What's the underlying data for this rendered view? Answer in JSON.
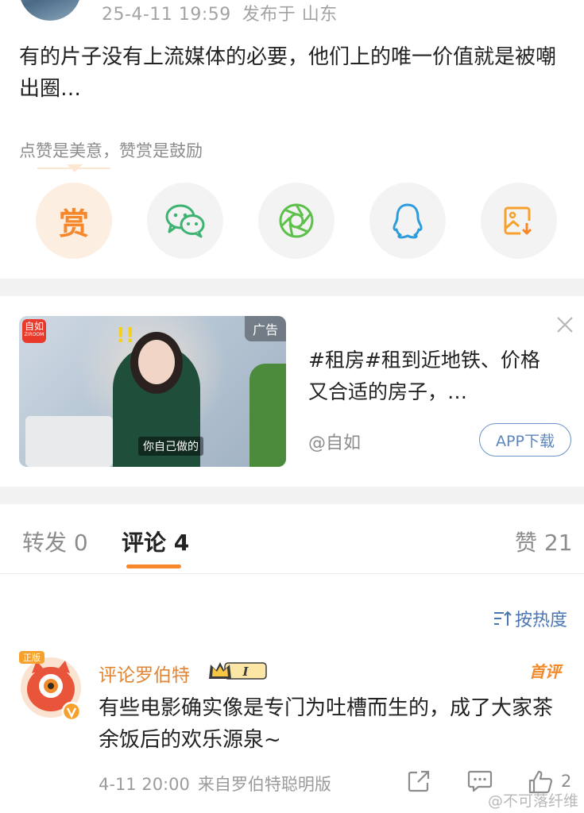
{
  "post": {
    "date": "25-4-11 19:59",
    "location": "发布于 山东",
    "text": "有的片子没有上流媒体的必要，他们上的唯一价值就是被嘲出圈…",
    "reward_hint": "点赞是美意，赞赏是鼓励",
    "reward_char": "赏"
  },
  "share": {
    "icons": [
      "reward-icon",
      "wechat-icon",
      "moments-icon",
      "qq-icon",
      "save-image-icon"
    ]
  },
  "ad": {
    "tag": "广告",
    "logo_text": "自如",
    "logo_sub": "ZIROOM",
    "image_caption": "你自己做的",
    "title": "#租房#租到近地铁、价格又合适的房子，…",
    "source": "@自如",
    "download_label": "APP下载"
  },
  "tabs": {
    "repost": "转发 0",
    "comments": "评论 4",
    "likes": "赞 21"
  },
  "sort": {
    "label": "按热度"
  },
  "comment": {
    "author": "评论罗伯特",
    "level_badge": "I",
    "first_label": "首评",
    "text": "有些电影确实像是专门为吐槽而生的，成了大家茶余饭后的欢乐源泉~",
    "time": "4-11 20:00",
    "source": "来自罗伯特聪明版",
    "like_count": "2"
  },
  "watermark": "@不可落纤维",
  "colors": {
    "accent": "#f6882b",
    "link_blue": "#4a77b4",
    "wechat_green": "#3cb371",
    "qq_blue": "#2d9cdb"
  }
}
